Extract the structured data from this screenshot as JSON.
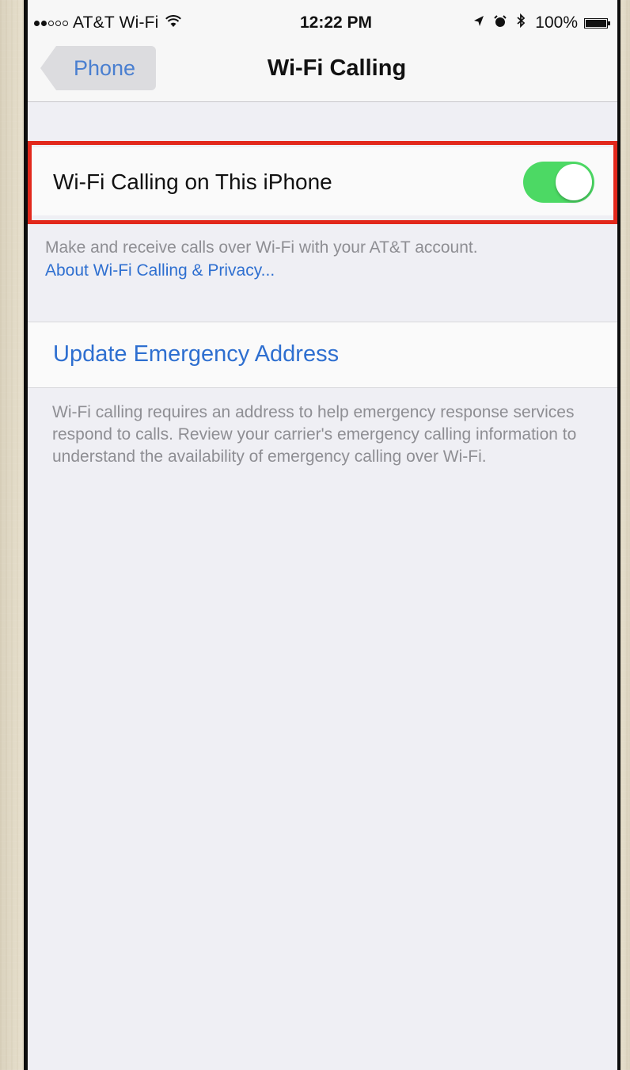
{
  "status_bar": {
    "carrier": "AT&T Wi-Fi",
    "time": "12:22 PM",
    "battery": "100%",
    "signal_bars_filled": 2,
    "signal_bars_total": 5
  },
  "nav": {
    "back_label": "Phone",
    "title": "Wi-Fi Calling"
  },
  "wifi_calling": {
    "label": "Wi-Fi Calling on This iPhone",
    "enabled": true,
    "footer": "Make and receive calls over Wi-Fi with your AT&T account.",
    "privacy_link": "About Wi-Fi Calling & Privacy..."
  },
  "emergency": {
    "label": "Update Emergency Address",
    "footer": "Wi-Fi calling requires an address to help emergency response services respond to calls. Review your carrier's emergency calling information to understand the availability of emergency calling over Wi-Fi."
  },
  "colors": {
    "accent": "#2e6fd0",
    "switch_on": "#4cd964",
    "highlight": "#e2281b",
    "background": "#efeff4"
  },
  "icons": [
    "wifi-icon",
    "location-arrow-icon",
    "alarm-icon",
    "bluetooth-icon",
    "battery-icon"
  ]
}
